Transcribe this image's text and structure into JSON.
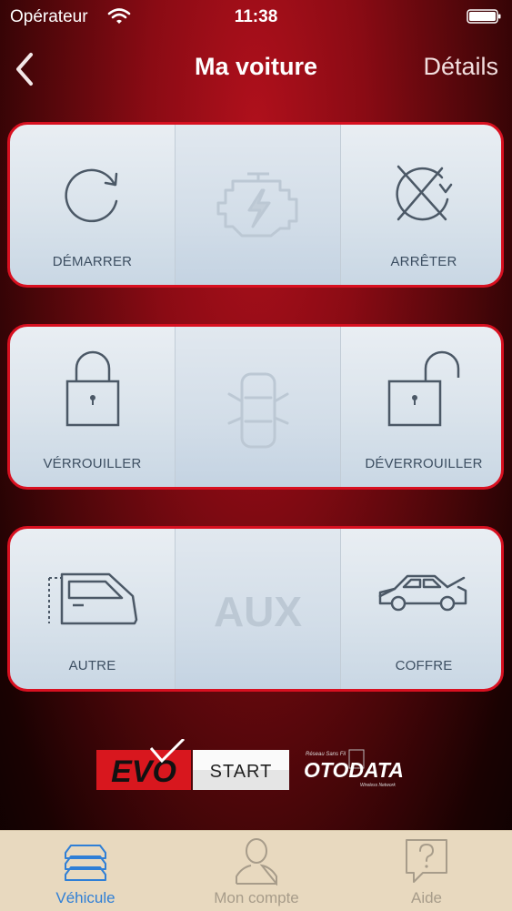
{
  "status_bar": {
    "carrier": "Opérateur",
    "time": "11:38"
  },
  "navbar": {
    "title": "Ma voiture",
    "details": "Détails"
  },
  "panels": [
    {
      "left": "DÉMARRER",
      "right": "ARRÊTER"
    },
    {
      "left": "VÉRROUILLER",
      "right": "DÉVERROUILLER"
    },
    {
      "left": "AUTRE",
      "center": "AUX",
      "right": "COFFRE"
    }
  ],
  "logos": {
    "evo": "EVO",
    "start": "START",
    "otodata": "OTODATA",
    "otodata_sub": "Réseau Sans Fil",
    "otodata_sub2": "Wireless Network"
  },
  "tabbar": {
    "tabs": [
      {
        "label": "Véhicule"
      },
      {
        "label": "Mon compte"
      },
      {
        "label": "Aide"
      }
    ]
  },
  "colors": {
    "accent_red": "#d81020",
    "tab_active": "#2f7fd6",
    "tab_inactive": "#a79c8a"
  },
  "icons": [
    "chevron-left-icon",
    "wifi-icon",
    "battery-icon",
    "restart-icon",
    "engine-icon",
    "stop-engine-icon",
    "lock-icon",
    "car-doors-icon",
    "unlock-icon",
    "car-door-icon",
    "car-trunk-icon",
    "car-stack-icon",
    "user-icon",
    "help-icon"
  ]
}
